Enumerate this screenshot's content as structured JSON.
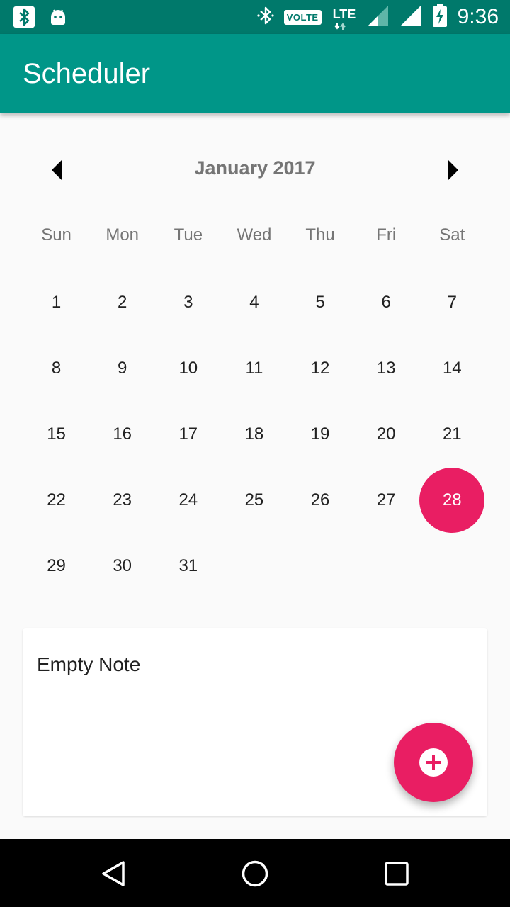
{
  "status_bar": {
    "time": "9:36",
    "volte_label": "VOLTE",
    "network_label": "LTE",
    "icons": [
      "bluetooth-icon",
      "android-icon",
      "bluetooth-icon",
      "signal-icon",
      "battery-charging-icon"
    ]
  },
  "app_bar": {
    "title": "Scheduler",
    "color": "#009688"
  },
  "calendar": {
    "month_label": "January 2017",
    "weekdays": [
      "Sun",
      "Mon",
      "Tue",
      "Wed",
      "Thu",
      "Fri",
      "Sat"
    ],
    "days": [
      "1",
      "2",
      "3",
      "4",
      "5",
      "6",
      "7",
      "8",
      "9",
      "10",
      "11",
      "12",
      "13",
      "14",
      "15",
      "16",
      "17",
      "18",
      "19",
      "20",
      "21",
      "22",
      "23",
      "24",
      "25",
      "26",
      "27",
      "28",
      "29",
      "30",
      "31"
    ],
    "selected_day": "28",
    "accent_color": "#e91e63"
  },
  "note": {
    "text": "Empty Note"
  },
  "fab": {
    "icon": "add-circle-icon"
  },
  "nav_bar": {
    "icons": [
      "back-icon",
      "home-icon",
      "recents-icon"
    ]
  }
}
